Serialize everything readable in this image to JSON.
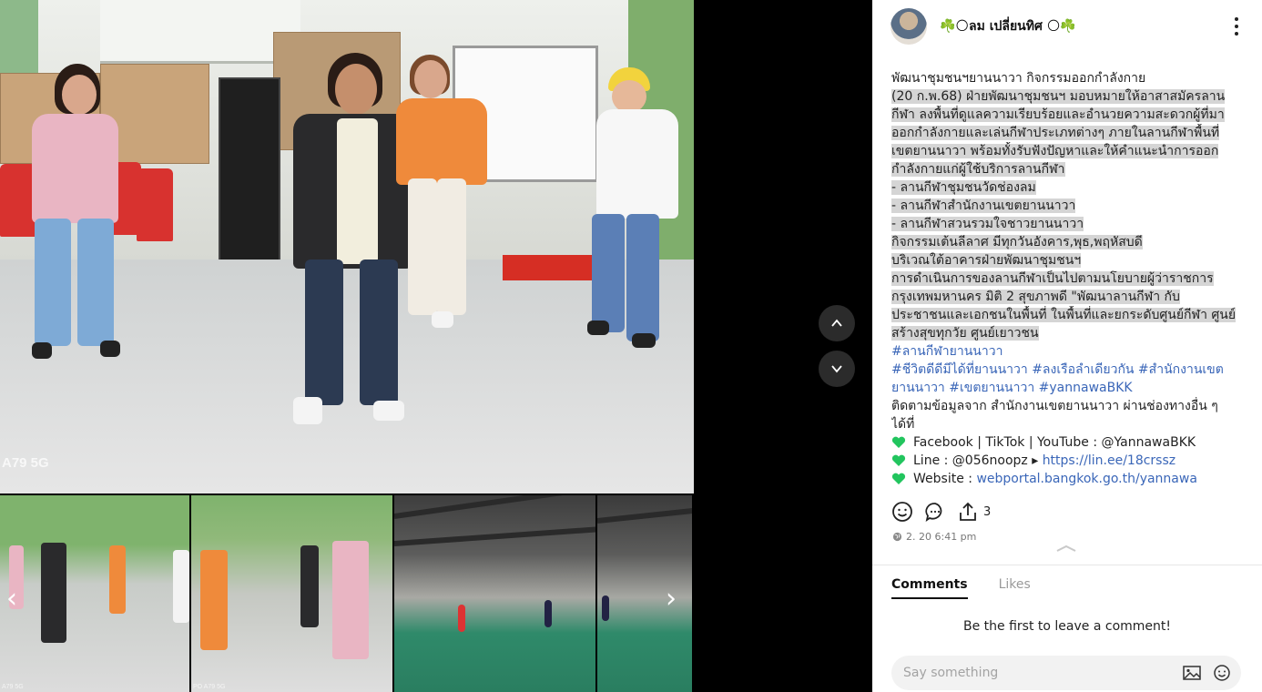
{
  "media": {
    "main_watermark": "A79 5G",
    "thumb_watermarks": [
      "A79 5G",
      "PO A79 5G"
    ],
    "prev_icon": "chevron-left-icon",
    "next_icon": "chevron-right-icon",
    "nav_up_icon": "chevron-up-icon",
    "nav_down_icon": "chevron-down-icon"
  },
  "post": {
    "author": "☘️🌕ลม เปลี่ยนทิศ 🌕☘️",
    "avatar_icon": "avatar",
    "more_icon": "more-vertical-icon",
    "caption": {
      "title": "พัฒนาชุมชนฯยานนาวา กิจกรรมออกกำลังกาย",
      "body_lines": [
        " (20 ก.พ.68)  ฝ่ายพัฒนาชุมชนฯ มอบหมายให้อาสาสมัครลาน",
        "กีฬา ลงพื้นที่ดูแลความเรียบร้อยและอำนวยความสะดวกผู้ที่มา",
        "ออกกำลังกายและเล่นกีฬาประเภทต่างๆ ภายในลานกีฬาพื้นที่",
        "เขตยานนาวา พร้อมทั้งรับฟังปัญหาและให้คำแนะนำการออก",
        "กำลังกายแก่ผู้ใช้บริการลานกีฬา",
        "- ลานกีฬาชุมชนวัดช่องลม",
        "- ลานกีฬาสำนักงานเขตยานนาวา",
        "- ลานกีฬาสวนรวมใจชาวยานนาวา",
        "กิจกรรมเต้นลีลาศ มีทุกวันอังคาร,พุธ,พฤหัสบดี",
        "บริเวณใต้อาคารฝ่ายพัฒนาชุมชนฯ",
        "   การดำเนินการของลานกีฬาเป็นไปตามนโยบายผู้ว่าราชการ",
        "กรุงเทพมหานคร  มิติ 2 สุขภาพดี  \"พัฒนาลานกีฬา กับ",
        "ประชาชนและเอกชนในพื้นที่ ในพื้นที่และยกระดับศูนย์กีฬา ศูนย์",
        "สร้างสุขทุกวัย ศูนย์เยาวชน"
      ],
      "hashtag_line1": "#ลานกีฬายานนาวา",
      "hashtag_line2": "#ชีวิตดีดีมีได้ที่ยานนาวา #ลงเรือลำเดียวกัน #สำนักงานเขต",
      "hashtag_line3": "ยานนาวา #เขตยานนาวา #yannawaBKK",
      "follow_line1": "ติดตามข้อมูลจาก สำนักงานเขตยานนาวา ผ่านช่องทางอื่น ๆ",
      "follow_line2": "ได้ที่",
      "contacts": [
        {
          "icon": "green-heart-icon",
          "label": "Facebook | TikTok | YouTube : @YannawaBKK",
          "link": ""
        },
        {
          "icon": "green-heart-icon",
          "label": "Line : @056noopz ▸ ",
          "link": "https://lin.ee/18crssz"
        },
        {
          "icon": "green-heart-icon",
          "label": "Website : ",
          "link": "webportal.bangkok.go.th/yannawa"
        }
      ]
    },
    "actions": {
      "like_icon": "smiley-icon",
      "comment_icon": "comment-bubble-icon",
      "share_icon": "share-icon",
      "share_count": "3"
    },
    "timestamp": "2. 20 6:41 pm",
    "timestamp_icon": "globe-icon",
    "collapse_icon": "chevron-up-icon"
  },
  "comments": {
    "tabs": [
      {
        "label": "Comments",
        "active": true
      },
      {
        "label": "Likes",
        "active": false
      }
    ],
    "empty_message": "Be the first to leave a comment!",
    "input_placeholder": "Say something",
    "image_icon": "image-icon",
    "emoji_icon": "emoji-icon"
  },
  "colors": {
    "link": "#3a66b8",
    "highlight": "#d5d5d5",
    "heart": "#22c55e"
  }
}
